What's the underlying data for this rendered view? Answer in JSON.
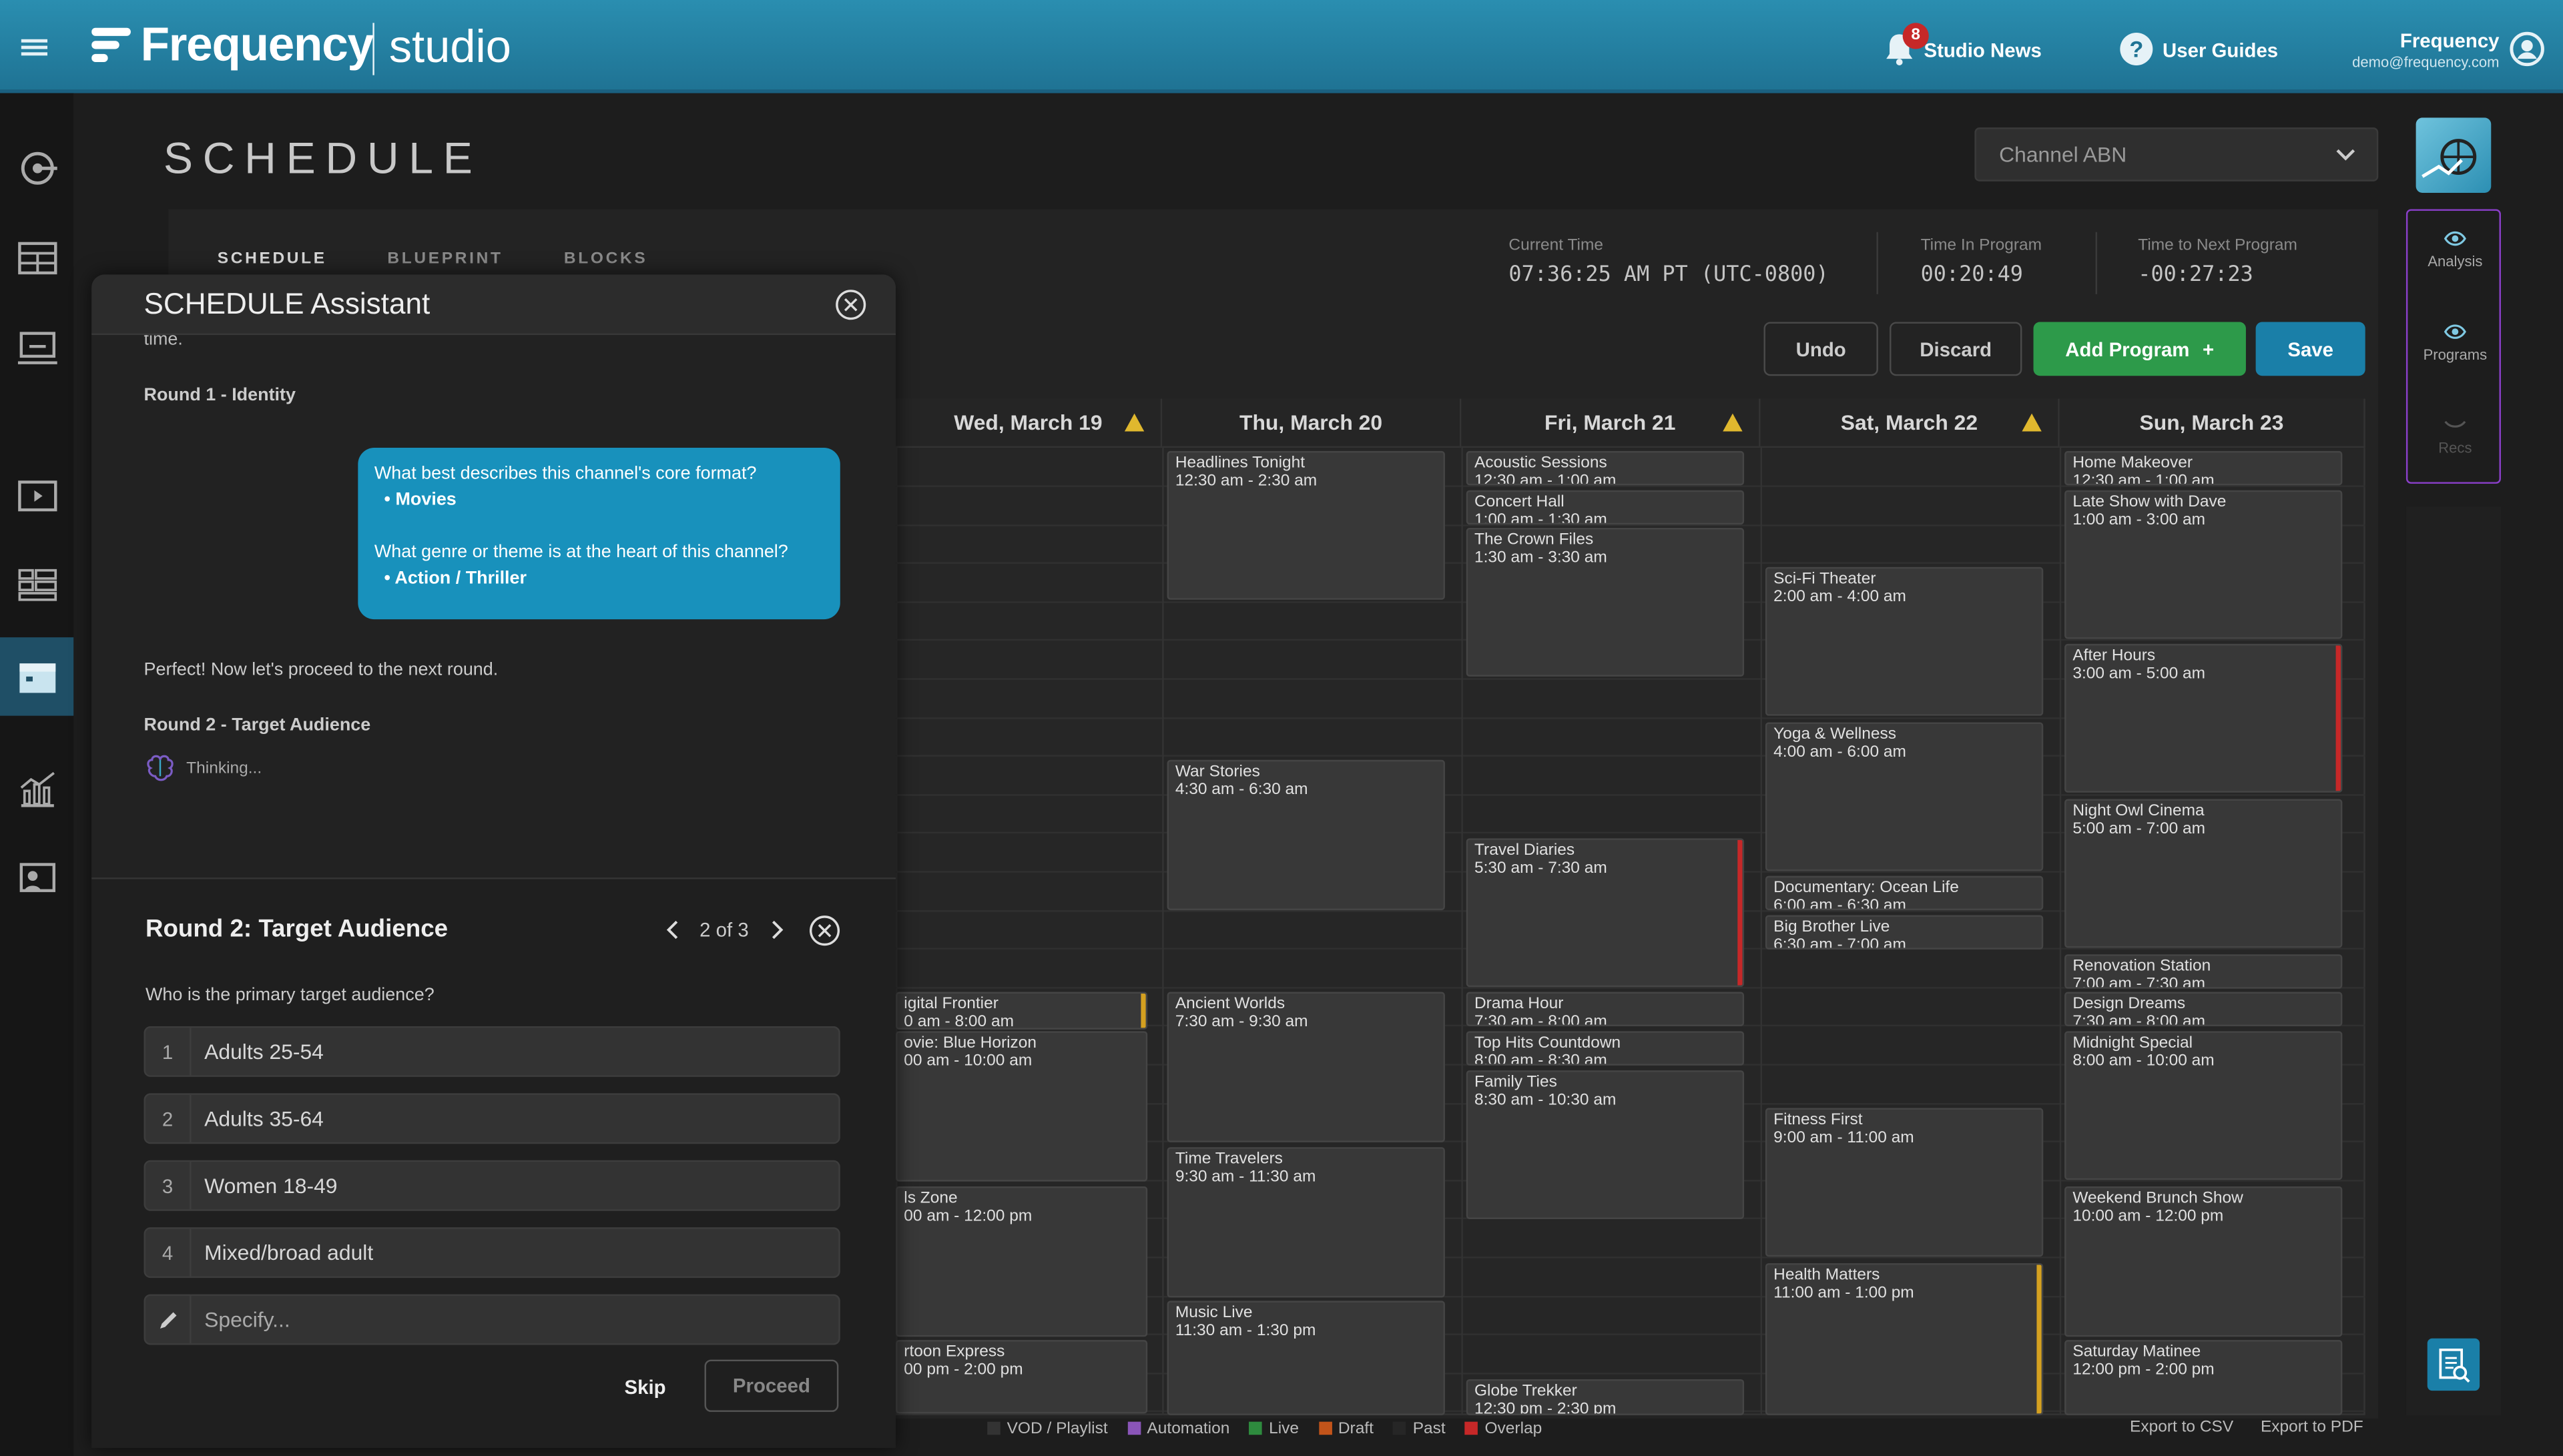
{
  "topbar": {
    "logo": "Frequency",
    "logo_studio": "studio",
    "news_badge": "8",
    "news_label": "Studio News",
    "guides_label": "User Guides",
    "user_name": "Frequency",
    "user_email": "demo@frequency.com"
  },
  "page": {
    "title": "SCHEDULE",
    "channel": "Channel ABN",
    "tabs": [
      "SCHEDULE",
      "BLUEPRINT",
      "BLOCKS"
    ],
    "current_time_label": "Current Time",
    "current_time": "07:36:25 AM PT (UTC-0800)",
    "time_in_label": "Time In Program",
    "time_in": "00:20:49",
    "time_next_label": "Time to Next Program",
    "time_next": "-00:27:23",
    "undo": "Undo",
    "discard": "Discard",
    "add_program": "Add Program",
    "save": "Save"
  },
  "days": [
    {
      "label": "Wed, March 19",
      "warn": true
    },
    {
      "label": "Thu, March 20",
      "warn": false
    },
    {
      "label": "Fri, March 21",
      "warn": true
    },
    {
      "label": "Sat, March 22",
      "warn": true
    },
    {
      "label": "Sun, March 23",
      "warn": false
    }
  ],
  "programs": {
    "wed": [
      {
        "title": "igital Frontier",
        "time": "0 am - 8:00 am",
        "flag": "gold"
      },
      {
        "title": "ovie: Blue Horizon",
        "time": "00 am - 10:00 am"
      },
      {
        "title": "ls Zone",
        "time": "00 am - 12:00 pm"
      },
      {
        "title": "rtoon Express",
        "time": "00 pm - 2:00 pm"
      }
    ],
    "thu": [
      {
        "title": "Headlines Tonight",
        "time": "12:30 am - 2:30 am"
      },
      {
        "title": "War Stories",
        "time": "4:30 am - 6:30 am"
      },
      {
        "title": "Ancient Worlds",
        "time": "7:30 am - 9:30 am"
      },
      {
        "title": "Time Travelers",
        "time": "9:30 am - 11:30 am"
      },
      {
        "title": "Music Live",
        "time": "11:30 am - 1:30 pm"
      }
    ],
    "fri": [
      {
        "title": "Acoustic Sessions",
        "time": "12:30 am - 1:00 am"
      },
      {
        "title": "Concert Hall",
        "time": "1:00 am - 1:30 am"
      },
      {
        "title": "The Crown Files",
        "time": "1:30 am - 3:30 am"
      },
      {
        "title": "Travel Diaries",
        "time": "5:30 am - 7:30 am",
        "flag": "red"
      },
      {
        "title": "Drama Hour",
        "time": "7:30 am - 8:00 am"
      },
      {
        "title": "Top Hits Countdown",
        "time": "8:00 am - 8:30 am"
      },
      {
        "title": "Family Ties",
        "time": "8:30 am - 10:30 am"
      },
      {
        "title": "Globe Trekker",
        "time": "12:30 pm - 2:30 pm"
      }
    ],
    "sat": [
      {
        "title": "Sci-Fi Theater",
        "time": "2:00 am - 4:00 am"
      },
      {
        "title": "Yoga & Wellness",
        "time": "4:00 am - 6:00 am"
      },
      {
        "title": "Documentary: Ocean Life",
        "time": "6:00 am - 6:30 am"
      },
      {
        "title": "Big Brother Live",
        "time": "6:30 am - 7:00 am"
      },
      {
        "title": "Fitness First",
        "time": "9:00 am - 11:00 am"
      },
      {
        "title": "Health Matters",
        "time": "11:00 am - 1:00 pm",
        "flag": "gold"
      }
    ],
    "sun": [
      {
        "title": "Home Makeover",
        "time": "12:30 am - 1:00 am"
      },
      {
        "title": "Late Show with Dave",
        "time": "1:00 am - 3:00 am"
      },
      {
        "title": "After Hours",
        "time": "3:00 am - 5:00 am",
        "flag": "red"
      },
      {
        "title": "Night Owl Cinema",
        "time": "5:00 am - 7:00 am"
      },
      {
        "title": "Renovation Station",
        "time": "7:00 am - 7:30 am"
      },
      {
        "title": "Design Dreams",
        "time": "7:30 am - 8:00 am"
      },
      {
        "title": "Midnight Special",
        "time": "8:00 am - 10:00 am"
      },
      {
        "title": "Weekend Brunch Show",
        "time": "10:00 am - 12:00 pm"
      },
      {
        "title": "Saturday Matinee",
        "time": "12:00 pm - 2:00 pm"
      }
    ]
  },
  "rail": {
    "analysis": "Analysis",
    "programs": "Programs",
    "recs": "Recs"
  },
  "legend": [
    {
      "label": "VOD / Playlist",
      "color": "#333333"
    },
    {
      "label": "Automation",
      "color": "#8a55b8"
    },
    {
      "label": "Live",
      "color": "#2e8b3e"
    },
    {
      "label": "Draft",
      "color": "#c2541a"
    },
    {
      "label": "Past",
      "color": "#262626"
    },
    {
      "label": "Overlap",
      "color": "#c62828"
    }
  ],
  "export_csv": "Export to CSV",
  "export_pdf": "Export to PDF",
  "assistant": {
    "title": "SCHEDULE Assistant",
    "cut_text": "time.",
    "round1": "Round 1 - Identity",
    "q1": "What best describes this channel's core format?",
    "a1": "Movies",
    "q2": "What genre or theme is at the heart of this channel?",
    "a2": "Action / Thriller",
    "proceed_msg": "Perfect! Now let's proceed to the next round.",
    "round2": "Round 2 - Target Audience",
    "thinking": "Thinking...",
    "card_title": "Round 2: Target Audience",
    "pager": "2 of 3",
    "question": "Who is the primary target audience?",
    "options": [
      "Adults 25-54",
      "Adults 35-64",
      "Women 18-49",
      "Mixed/broad adult"
    ],
    "option_nums": [
      "1",
      "2",
      "3",
      "4"
    ],
    "specify_placeholder": "Specify...",
    "skip": "Skip",
    "proceed": "Proceed"
  }
}
